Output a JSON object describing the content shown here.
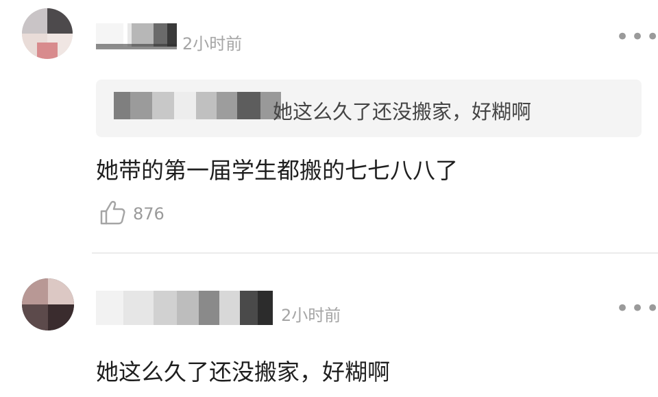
{
  "comments": [
    {
      "time": "2小时前",
      "more_label": "•••",
      "quote": {
        "text": "她这么久了还没搬家，好糊啊"
      },
      "text": "她带的第一届学生都搬的七七八八了",
      "likes": "876",
      "like_icon": "thumbs-up-icon"
    },
    {
      "time": "2小时前",
      "more_label": "•••",
      "text": "她这么久了还没搬家，好糊啊"
    }
  ],
  "colors": {
    "background": "#ffffff",
    "quote_background": "#f4f4f4",
    "muted_text": "#a5a5a5",
    "main_text": "#1f1f1f"
  }
}
